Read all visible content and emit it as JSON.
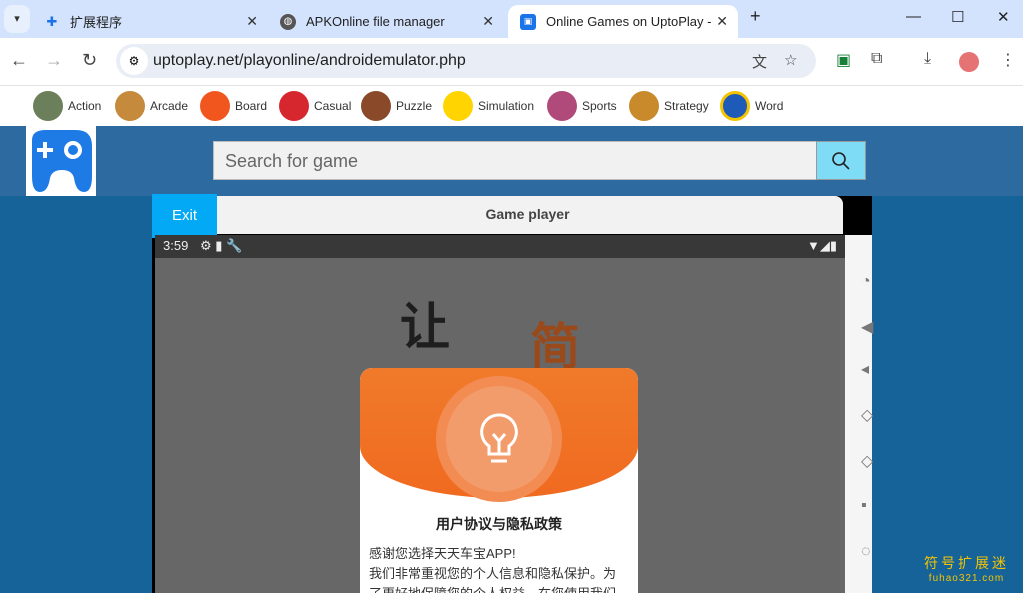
{
  "browser": {
    "tabs": [
      {
        "label": "扩展程序",
        "icon": "puzzle-icon"
      },
      {
        "label": "APKOnline file manager",
        "icon": "globe-icon"
      },
      {
        "label": "Online Games on UptoPlay -",
        "icon": "uptoplay-icon",
        "active": true
      }
    ],
    "new_tab": "+",
    "url": "uptoplay.net/playonline/androidemulator.php",
    "bookmarks": [
      "Action",
      "Arcade",
      "Board",
      "Casual",
      "Puzzle",
      "Simulation",
      "Sports",
      "Strategy",
      "Word"
    ]
  },
  "site": {
    "search_placeholder": "Search for game"
  },
  "player": {
    "exit_label": "Exit",
    "title": "Game player",
    "status_time": "3:59",
    "dialog": {
      "title": "用户协议与隐私政策",
      "line1": "感谢您选择天天车宝APP!",
      "line2": "我们非常重视您的个人信息和隐私保护。为",
      "line3": "了更好地保障您的个人权益，在您使用我们"
    }
  },
  "watermark": {
    "name": "符号扩展迷",
    "domain": "fuhao321.com"
  }
}
